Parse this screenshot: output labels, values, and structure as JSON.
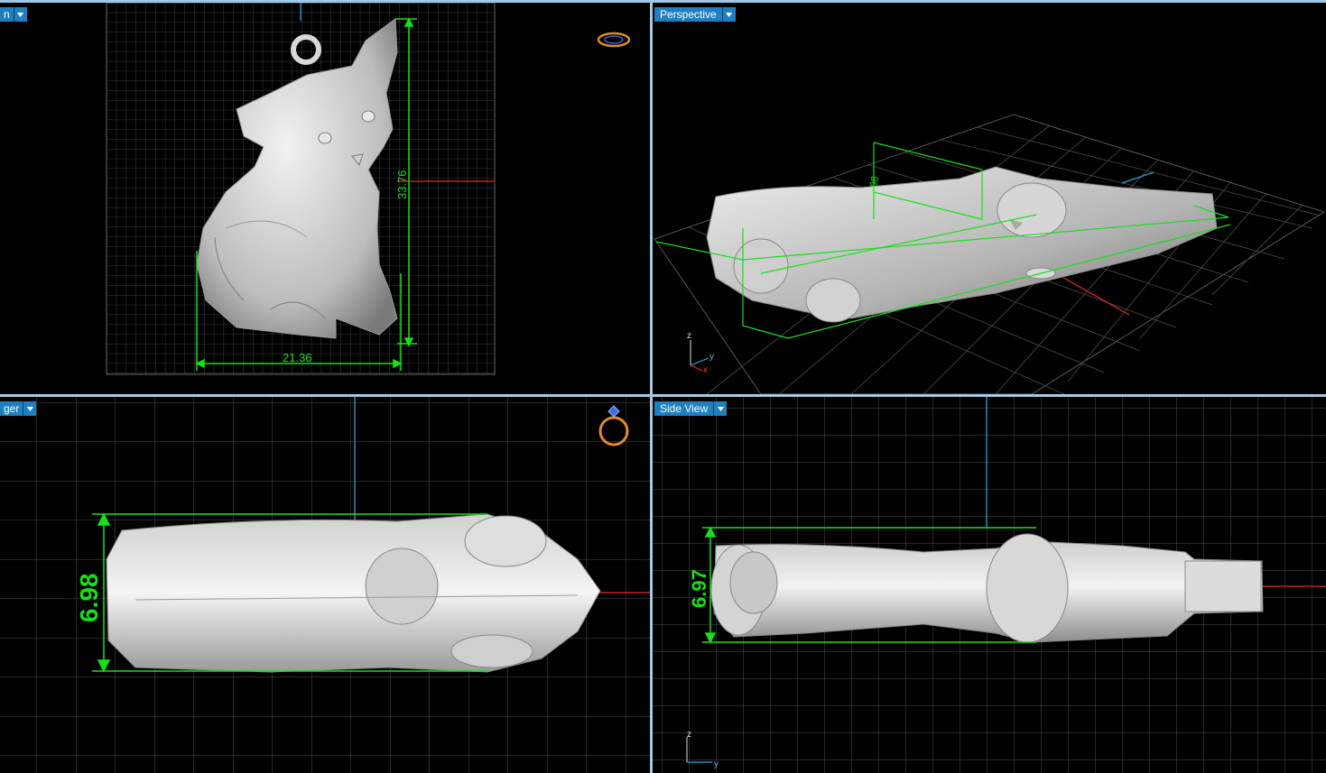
{
  "viewports": {
    "front": {
      "label": "n"
    },
    "perspective": {
      "label": "Perspective"
    },
    "top": {
      "label": "ger"
    },
    "side": {
      "label": "Side View"
    }
  },
  "dimensions": {
    "height": "33.76",
    "width": "21.36",
    "perspective_depth": "98",
    "top_thickness": "6.98",
    "side_thickness": "6.97"
  },
  "axes": {
    "x": "x",
    "y": "y",
    "z": "z"
  },
  "icons": {
    "nav_front": "ring-navigator-icon",
    "nav_top": "ring-icon",
    "dropdown": "chevron-down-icon"
  },
  "colors": {
    "dimension": "#18e018",
    "axis_x": "#c42020",
    "axis_y": "#2a8ab8",
    "grid": "#5a5a5a",
    "label_bg": "#1f7fbf",
    "border": "#a9c8de"
  }
}
